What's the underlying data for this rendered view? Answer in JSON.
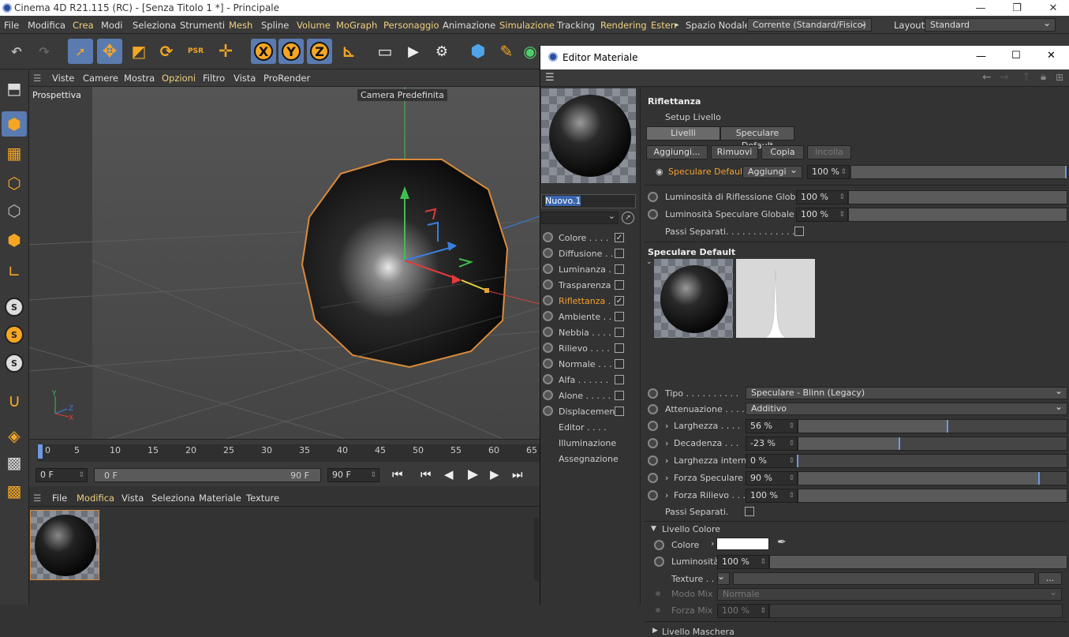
{
  "app": {
    "title": "Cinema 4D R21.115 (RC) - [Senza Titolo 1 *] - Principale"
  },
  "menubar": {
    "items": [
      "File",
      "Modifica",
      "Crea",
      "Modi",
      "Seleziona",
      "Strumenti",
      "Mesh",
      "Spline",
      "Volume",
      "MoGraph",
      "Personaggio",
      "Animazione",
      "Simulazione",
      "Tracking",
      "Rendering",
      "Esten"
    ],
    "spazio_label": "Spazio Nodale:",
    "spazio_value": "Corrente (Standard/Fisico)",
    "layout_label": "Layout:",
    "layout_value": "Standard"
  },
  "toolbar": {
    "x": "X",
    "y": "Y",
    "z": "Z",
    "psr": "PSR"
  },
  "viewport": {
    "menu": [
      "Viste",
      "Camere",
      "Mostra",
      "Opzioni",
      "Filtro",
      "Vista",
      "ProRender"
    ],
    "label": "Prospettiva",
    "camera": "Camera Predefinita"
  },
  "timeline": {
    "ticks": [
      "0",
      "5",
      "10",
      "15",
      "20",
      "25",
      "30",
      "35",
      "40",
      "45",
      "50",
      "55",
      "60",
      "65"
    ],
    "start": "0 F",
    "range_start": "0 F",
    "range_end": "90 F",
    "end": "90 F"
  },
  "matmgr": {
    "menu": [
      "File",
      "Modifica",
      "Vista",
      "Seleziona",
      "Materiale",
      "Texture"
    ]
  },
  "editor": {
    "title": "Editor Materiale",
    "name": "Nuovo.1",
    "channels": [
      {
        "label": "Colore . . . .",
        "checked": "✓"
      },
      {
        "label": "Diffusione . .",
        "checked": ""
      },
      {
        "label": "Luminanza . .",
        "checked": ""
      },
      {
        "label": "Trasparenza",
        "checked": ""
      },
      {
        "label": "Riflettanza . .",
        "checked": "✓"
      },
      {
        "label": "Ambiente . .",
        "checked": ""
      },
      {
        "label": "Nebbia . . . .",
        "checked": ""
      },
      {
        "label": "Rilievo . . . .",
        "checked": ""
      },
      {
        "label": "Normale . . .",
        "checked": ""
      },
      {
        "label": "Alfa . . . . . .",
        "checked": ""
      },
      {
        "label": "Alone . . . . .",
        "checked": ""
      },
      {
        "label": "Displacement",
        "checked": ""
      }
    ],
    "extra": [
      "Editor . . . .",
      "Illuminazione",
      "Assegnazione"
    ],
    "section": "Riflettanza",
    "setup": "Setup Livello",
    "tab1": "Livelli",
    "tab2": "Speculare Default",
    "btn_add": "Aggiungi...",
    "btn_remove": "Rimuovi",
    "btn_copy": "Copia",
    "btn_paste": "Incolla",
    "layer_name": "Speculare Default",
    "layer_mode": "Aggiungi",
    "layer_pct": "100 %",
    "layer_fill": 1.0,
    "glob_refl_label": "Luminosità di Riflessione Globale",
    "glob_refl": "100 %",
    "glob_spec_label": "Luminosità Speculare Globale .",
    "glob_spec": "100 %",
    "passi1": "Passi Separati. . . . . . . . . . . . . .",
    "spec_header": "Speculare Default",
    "tipo_label": "Tipo . . . . . . . . . .",
    "tipo": "Speculare - Blinn (Legacy)",
    "att_label": "Attenuazione . . . .",
    "att": "Additivo",
    "params": [
      {
        "label": "Larghezza . . . .",
        "value": "56 %",
        "fill": 0.56
      },
      {
        "label": "Decadenza . . .",
        "value": "-23 %",
        "fill": 0.38
      },
      {
        "label": "Larghezza interna",
        "value": "0 %",
        "fill": 0.0
      },
      {
        "label": "Forza Speculare",
        "value": "90 %",
        "fill": 0.9
      },
      {
        "label": "Forza Rilievo . . .",
        "value": "100 %",
        "fill": 1.0
      }
    ],
    "passi2": "Passi Separati.",
    "livello_colore": "Livello Colore",
    "colore": "Colore",
    "luminosita": "Luminosità",
    "lum_value": "100 %",
    "texture": "Texture . .",
    "modo_mix": "Modo Mix",
    "modo_value": "Normale",
    "forza_mix": "Forza Mix",
    "forza_value": "100 %",
    "livello_maschera": "Livello Maschera",
    "dots": "..."
  }
}
